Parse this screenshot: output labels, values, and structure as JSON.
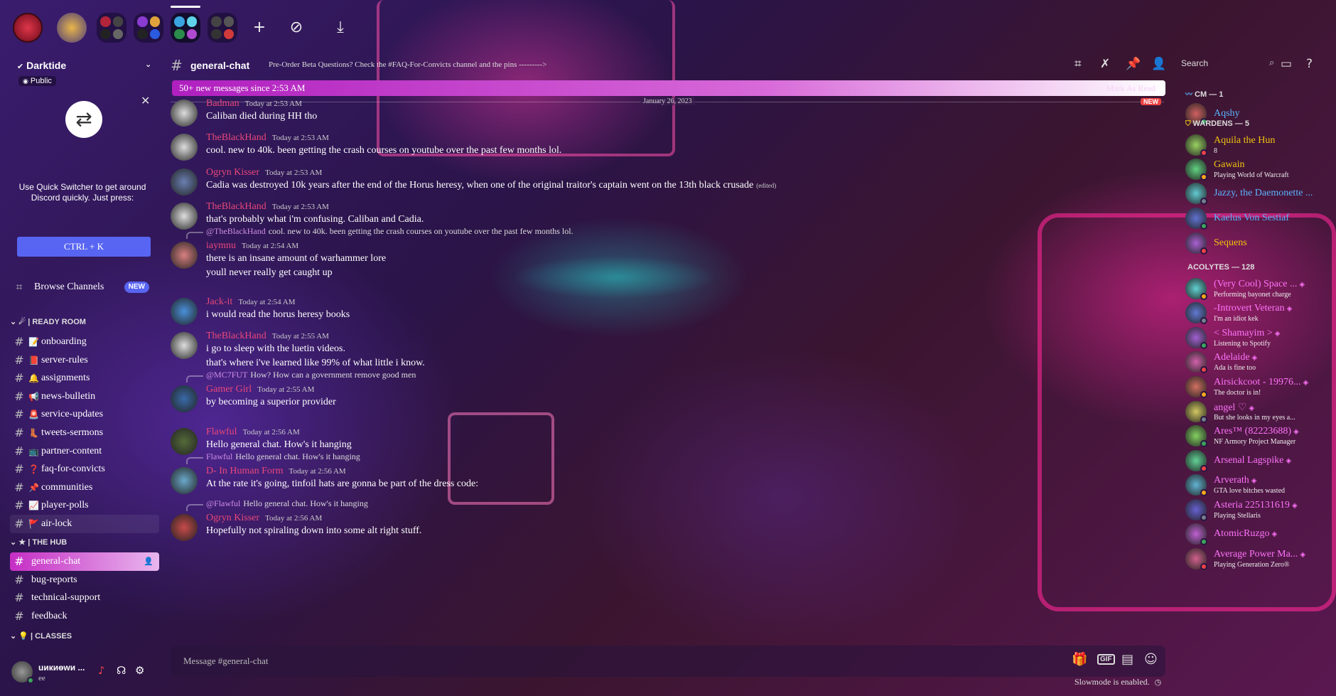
{
  "colors": {
    "accent": "#5865f2",
    "mention_pink": "#e9477a",
    "member_blue": "#5ab3ff",
    "gold": "#f1c40f",
    "magenta": "#ff73fa"
  },
  "servers": {
    "icons": [
      "server-red-avatar",
      "server-portrait",
      "folder-1",
      "folder-2",
      "folder-3",
      "folder-4"
    ],
    "add_label": "+",
    "explore_icon": "compass-icon",
    "download_icon": "download-icon"
  },
  "guild": {
    "name": "Darktide",
    "public_label": "Public"
  },
  "quick_switcher": {
    "text": "Use Quick Switcher to get around Discord quickly. Just press:",
    "button": "CTRL + K"
  },
  "browse": {
    "label": "Browse Channels",
    "badge": "NEW"
  },
  "categories": {
    "ready_room": "| READY ROOM",
    "the_hub": "| THE HUB",
    "classes": "| CLASSES"
  },
  "channels_ready": [
    {
      "name": "onboarding",
      "icon": "📝"
    },
    {
      "name": "server-rules",
      "icon": "📕"
    },
    {
      "name": "assignments",
      "icon": "🔔"
    },
    {
      "name": "news-bulletin",
      "icon": "📢"
    },
    {
      "name": "service-updates",
      "icon": "🚨"
    },
    {
      "name": "tweets-sermons",
      "icon": "👢"
    },
    {
      "name": "partner-content",
      "icon": "📺"
    },
    {
      "name": "faq-for-convicts",
      "icon": "❓"
    },
    {
      "name": "communities",
      "icon": "📌"
    },
    {
      "name": "player-polls",
      "icon": "📈"
    },
    {
      "name": "air-lock",
      "icon": "🚩"
    }
  ],
  "channels_hub": [
    {
      "name": "general-chat"
    },
    {
      "name": "bug-reports"
    },
    {
      "name": "technical-support"
    },
    {
      "name": "feedback"
    }
  ],
  "user": {
    "name": "uикиѳwи ...",
    "status": "ee"
  },
  "header": {
    "channel": "general-chat",
    "topic": "Pre-Order Beta Questions? Check the #FAQ-For-Convicts channel and the pins --------->",
    "search_placeholder": "Search"
  },
  "banner": {
    "text": "50+ new messages since 2:53 AM",
    "mark": "Mark As Read"
  },
  "divider": {
    "date": "January 26, 2023",
    "new": "NEW"
  },
  "messages": [
    {
      "author": "Badman",
      "ts": "Today at 2:53 AM",
      "lines": [
        "Caliban died during HH tho"
      ]
    },
    {
      "author": "TheBlackHand",
      "ts": "Today at 2:53 AM",
      "lines": [
        "cool. new to 40k. been getting the crash courses on youtube over the past few months lol."
      ]
    },
    {
      "author": "Ogryn Kisser",
      "ts": "Today at 2:53 AM",
      "lines": [
        "Cadia was destroyed 10k years after the end of the Horus heresy, when one of the original traitor's captain went on the 13th black crusade"
      ],
      "edited": "(edited)"
    },
    {
      "author": "TheBlackHand",
      "ts": "Today at 2:53 AM",
      "lines": [
        "that's probably what i'm confusing. Caliban and Cadia."
      ]
    },
    {
      "reply_to": "@TheBlackHand",
      "reply_text": "cool. new to 40k. been getting the crash courses on youtube over the past few months lol.",
      "author": "iaymnu",
      "ts": "Today at 2:54 AM",
      "lines": [
        "there is an insane amount of warhammer lore",
        "youll never really get caught up"
      ]
    },
    {
      "author": "Jack-it",
      "ts": "Today at 2:54 AM",
      "lines": [
        "i would read the horus heresy books"
      ]
    },
    {
      "author": "TheBlackHand",
      "ts": "Today at 2:55 AM",
      "lines": [
        "i go to sleep with the luetin videos.",
        "that's where i've learned like 99% of what little i know."
      ]
    },
    {
      "reply_to": "@MC7FUT",
      "reply_text": "How? How can a government remove good men",
      "author": "Gamer Girl",
      "ts": "Today at 2:55 AM",
      "lines": [
        "by becoming a superior provider"
      ]
    },
    {
      "author": "Flawful",
      "ts": "Today at 2:56 AM",
      "lines": [
        "Hello general chat. How's it hanging"
      ]
    },
    {
      "reply_to": "Flawful",
      "reply_text": "Hello general chat. How's it hanging",
      "author": "D- In Human Form",
      "ts": "Today at 2:56 AM",
      "lines": [
        "At the rate it's going, tinfoil hats are gonna be part of the dress code:"
      ]
    },
    {
      "reply_to": "@Flawful",
      "reply_text": "Hello general chat. How's it hanging",
      "author": "Ogryn Kisser",
      "ts": "Today at 2:56 AM",
      "lines": [
        "Hopefully not spiraling down into some alt right stuff."
      ]
    }
  ],
  "composer": {
    "placeholder": "Message #general-chat",
    "slowmode": "Slowmode is enabled."
  },
  "members": {
    "groups": [
      {
        "title": "CM — 1"
      },
      {
        "title": "WARDENS — 5"
      },
      {
        "title": "ACOLYTES — 128"
      }
    ],
    "cm": [
      {
        "name": "Aqshy",
        "activity": ""
      }
    ],
    "wardens": [
      {
        "name": "Aquila the Hun",
        "activity": "8"
      },
      {
        "name": "Gawain",
        "activity": "Playing World of Warcraft"
      },
      {
        "name": "Jazzy, the Daemonette ...",
        "activity": ""
      },
      {
        "name": "Kaelus Von Sestiaf",
        "activity": ""
      },
      {
        "name": "Sequens",
        "activity": ""
      }
    ],
    "acolytes": [
      {
        "name": "(Very Cool) Space ...",
        "activity": "Performing bayonet charge"
      },
      {
        "name": "-Introvert Veteran",
        "activity": "I'm an idiot kek"
      },
      {
        "name": "< Shamayim >",
        "activity": "Listening to Spotify"
      },
      {
        "name": "Adelaide",
        "activity": "Ada is fine too"
      },
      {
        "name": "Airsickcoot - 19976...",
        "activity": "The doctor is in!"
      },
      {
        "name": "angel ♡",
        "activity": "But she looks in my eyes a..."
      },
      {
        "name": "Ares™ (82223688)",
        "activity": "NF Armory Project Manager"
      },
      {
        "name": "Arsenal Lagspike",
        "activity": ""
      },
      {
        "name": "Arverath",
        "activity": "GTA love bitches wasted"
      },
      {
        "name": "Asteria 225131619",
        "activity": "Playing Stellaris"
      },
      {
        "name": "AtomicRuzgo",
        "activity": ""
      },
      {
        "name": "Average Power Ma...",
        "activity": "Playing Generation Zero®"
      }
    ]
  }
}
